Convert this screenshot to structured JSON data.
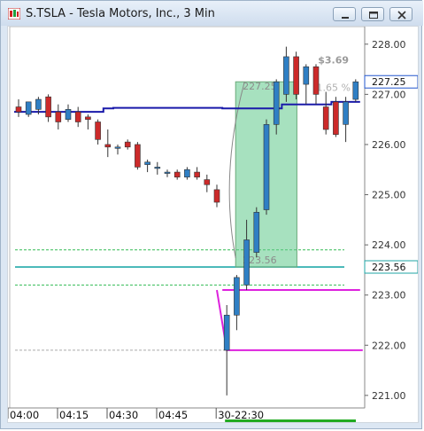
{
  "window": {
    "title": "S.TSLA - Tesla Motors, Inc., 3 Min",
    "minimize_label": "minimize",
    "restore_label": "restore",
    "close_label": "close"
  },
  "chart_data": {
    "type": "candlestick",
    "symbol": "S.TSLA",
    "interval": "3 Min",
    "y_axis_ticks": [
      "228.00",
      "227.00",
      "226.00",
      "225.00",
      "224.00",
      "223.00",
      "222.00",
      "221.00"
    ],
    "ylim": [
      220.75,
      228.35
    ],
    "x_axis_ticks": [
      "04:00",
      "04:15",
      "04:30",
      "04:45",
      "30-22:30"
    ],
    "price_labels": [
      {
        "value": 227.25,
        "text": "227.25",
        "color": "#2255cc"
      },
      {
        "value": 223.56,
        "text": "223.56",
        "color": "#1fa5a5"
      }
    ],
    "annotations": {
      "gain_label": "$3.69",
      "pct_label": "1.65 %",
      "box_top_label": "227.25",
      "box_bottom_label": "223.56"
    },
    "candles": [
      {
        "o": 226.75,
        "h": 226.9,
        "l": 226.55,
        "c": 226.65
      },
      {
        "o": 226.6,
        "h": 226.85,
        "l": 226.55,
        "c": 226.85
      },
      {
        "o": 226.7,
        "h": 226.95,
        "l": 226.6,
        "c": 226.9
      },
      {
        "o": 226.95,
        "h": 227.0,
        "l": 226.45,
        "c": 226.55
      },
      {
        "o": 226.65,
        "h": 226.8,
        "l": 226.3,
        "c": 226.45
      },
      {
        "o": 226.5,
        "h": 226.8,
        "l": 226.45,
        "c": 226.7
      },
      {
        "o": 226.65,
        "h": 226.75,
        "l": 226.35,
        "c": 226.45
      },
      {
        "o": 226.55,
        "h": 226.6,
        "l": 226.3,
        "c": 226.5
      },
      {
        "o": 226.45,
        "h": 226.5,
        "l": 226.0,
        "c": 226.1
      },
      {
        "o": 226.0,
        "h": 226.3,
        "l": 225.75,
        "c": 225.95
      },
      {
        "o": 225.95,
        "h": 226.0,
        "l": 225.8,
        "c": 225.95
      },
      {
        "o": 226.05,
        "h": 226.1,
        "l": 225.9,
        "c": 225.95
      },
      {
        "o": 226.0,
        "h": 226.05,
        "l": 225.5,
        "c": 225.55
      },
      {
        "o": 225.6,
        "h": 225.7,
        "l": 225.45,
        "c": 225.65
      },
      {
        "o": 225.55,
        "h": 225.65,
        "l": 225.4,
        "c": 225.55
      },
      {
        "o": 225.45,
        "h": 225.5,
        "l": 225.35,
        "c": 225.45
      },
      {
        "o": 225.45,
        "h": 225.5,
        "l": 225.3,
        "c": 225.35
      },
      {
        "o": 225.35,
        "h": 225.55,
        "l": 225.3,
        "c": 225.5
      },
      {
        "o": 225.45,
        "h": 225.55,
        "l": 225.3,
        "c": 225.35
      },
      {
        "o": 225.3,
        "h": 225.4,
        "l": 225.05,
        "c": 225.2
      },
      {
        "o": 225.1,
        "h": 225.2,
        "l": 224.75,
        "c": 224.85
      },
      {
        "o": 221.9,
        "h": 222.8,
        "l": 221.0,
        "c": 222.6
      },
      {
        "o": 222.6,
        "h": 223.4,
        "l": 222.3,
        "c": 223.35
      },
      {
        "o": 223.2,
        "h": 224.5,
        "l": 223.1,
        "c": 224.1
      },
      {
        "o": 223.85,
        "h": 224.75,
        "l": 223.75,
        "c": 224.65
      },
      {
        "o": 224.7,
        "h": 226.5,
        "l": 224.6,
        "c": 226.4
      },
      {
        "o": 226.4,
        "h": 227.3,
        "l": 226.2,
        "c": 227.25
      },
      {
        "o": 227.0,
        "h": 227.95,
        "l": 226.85,
        "c": 227.75
      },
      {
        "o": 227.75,
        "h": 227.85,
        "l": 226.9,
        "c": 227.0
      },
      {
        "o": 227.2,
        "h": 227.6,
        "l": 226.8,
        "c": 227.55
      },
      {
        "o": 227.55,
        "h": 227.6,
        "l": 226.8,
        "c": 227.0
      },
      {
        "o": 226.75,
        "h": 227.05,
        "l": 226.2,
        "c": 226.3
      },
      {
        "o": 226.85,
        "h": 226.95,
        "l": 226.15,
        "c": 226.2
      },
      {
        "o": 226.4,
        "h": 226.95,
        "l": 226.05,
        "c": 226.85
      },
      {
        "o": 226.9,
        "h": 227.3,
        "l": 226.85,
        "c": 227.25
      }
    ],
    "series": [
      {
        "color": "#1a1aaa",
        "values": [
          226.65,
          226.65,
          226.65,
          226.65,
          226.65,
          226.65,
          226.65,
          226.65,
          226.65,
          226.72,
          226.73,
          226.73,
          226.73,
          226.73,
          226.73,
          226.73,
          226.73,
          226.73,
          226.73,
          226.73,
          226.73,
          226.72,
          226.72,
          226.72,
          226.72,
          226.72,
          226.72,
          226.8,
          226.8,
          226.8,
          226.8,
          226.8,
          226.85,
          226.85,
          226.85
        ]
      },
      {
        "color": "#dd22dd",
        "values": [
          null,
          null,
          null,
          null,
          null,
          null,
          null,
          null,
          null,
          null,
          null,
          null,
          null,
          null,
          null,
          null,
          null,
          null,
          null,
          null,
          null,
          223.1,
          223.1,
          223.1,
          223.1,
          223.1,
          223.1,
          223.1,
          223.1,
          223.1,
          223.1,
          223.1,
          223.1,
          223.1,
          223.1
        ]
      }
    ]
  }
}
